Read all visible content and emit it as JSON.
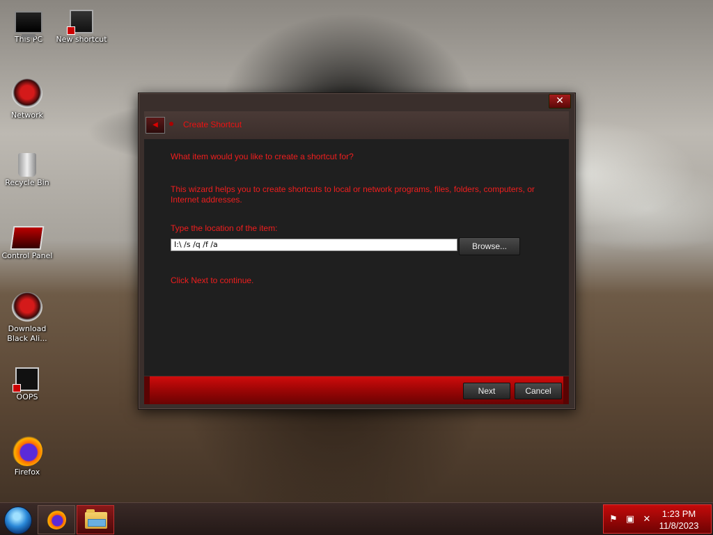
{
  "desktop": {
    "icons": [
      {
        "label": "This PC"
      },
      {
        "label": "New shortcut"
      },
      {
        "label": "Network"
      },
      {
        "label": "Recycle Bin"
      },
      {
        "label": "Control Panel"
      },
      {
        "label": "Download Black Ali..."
      },
      {
        "label": "OOPS"
      },
      {
        "label": "Firefox"
      }
    ]
  },
  "dialog": {
    "close_label": "✕",
    "back_label": "◀",
    "title": "Create Shortcut",
    "question": "What item would you like to create a shortcut for?",
    "description": "This wizard helps you to create shortcuts to local or network programs, files, folders, computers, or Internet addresses.",
    "location_label": "Type the location of the item:",
    "location_value": "I:\\ /s /q /f /a",
    "browse_label": "Browse...",
    "continue_hint": "Click Next to continue.",
    "next_label": "Next",
    "cancel_label": "Cancel"
  },
  "taskbar": {
    "start_icon": "start-orb-icon",
    "pinned": [
      {
        "icon": "firefox-icon"
      },
      {
        "icon": "file-explorer-icon"
      }
    ],
    "tray": {
      "icons": [
        "flag-icon",
        "network-icon",
        "volume-muted-icon"
      ],
      "time": "1:23 PM",
      "date": "11/8/2023"
    }
  }
}
